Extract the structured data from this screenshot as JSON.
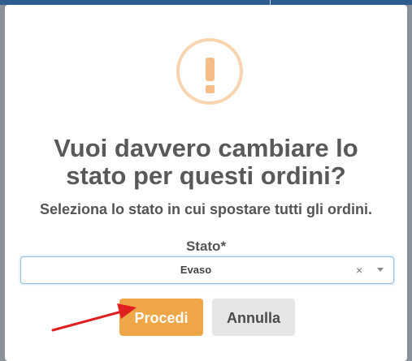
{
  "dialog": {
    "icon": "exclamation-icon",
    "title": "Vuoi davvero cambiare lo stato per questi ordini?",
    "subtitle": "Seleziona lo stato in cui spostare tutti gli ordini.",
    "field_label": "Stato*",
    "select": {
      "value": "Evaso",
      "clear_symbol": "×"
    },
    "confirm_label": "Procedi",
    "cancel_label": "Annulla"
  },
  "annotation": {
    "type": "arrow-icon",
    "color": "#e02020"
  },
  "colors": {
    "confirm": "#efa647",
    "cancel": "#e6e6e6",
    "warning": "#f6bd86"
  }
}
